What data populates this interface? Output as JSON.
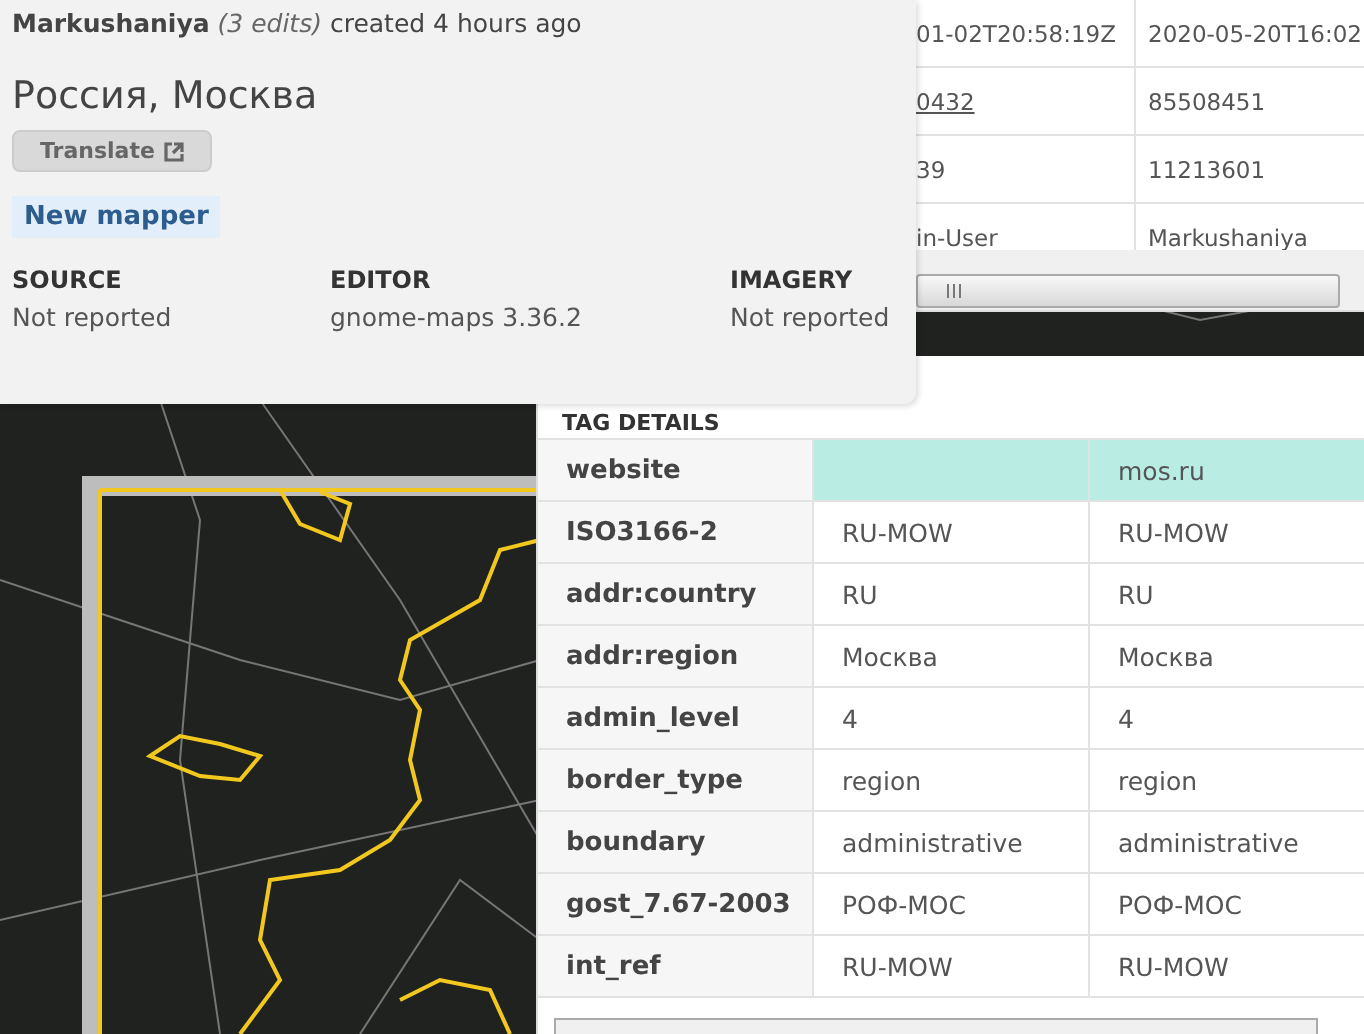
{
  "popup": {
    "author": "Markushaniya",
    "edits": "(3 edits)",
    "created": "created 4 hours ago",
    "title": "Россия, Москва",
    "translate_button": "Translate",
    "badge": "New mapper",
    "meta": [
      {
        "label": "SOURCE",
        "value": "Not reported"
      },
      {
        "label": "EDITOR",
        "value": "gnome-maps 3.36.2"
      },
      {
        "label": "IMAGERY",
        "value": "Not reported"
      }
    ]
  },
  "history_table": {
    "rows": [
      {
        "column_1": "01-02T20:58:19Z",
        "column_2": "2020-05-20T16:02",
        "link": false
      },
      {
        "column_1": "0432",
        "column_2": "85508451",
        "link": true
      },
      {
        "column_1": "39",
        "column_2": "11213601",
        "link": false
      },
      {
        "column_1": "in-User",
        "column_2": "Markushaniya",
        "link": false
      }
    ]
  },
  "tag_details": {
    "title": "TAG DETAILS",
    "rows": [
      {
        "key": "website",
        "old": "",
        "new": "mos.ru",
        "changed": true
      },
      {
        "key": "ISO3166-2",
        "old": "RU-MOW",
        "new": "RU-MOW",
        "changed": false
      },
      {
        "key": "addr:country",
        "old": "RU",
        "new": "RU",
        "changed": false
      },
      {
        "key": "addr:region",
        "old": "Москва",
        "new": "Москва",
        "changed": false
      },
      {
        "key": "admin_level",
        "old": "4",
        "new": "4",
        "changed": false
      },
      {
        "key": "border_type",
        "old": "region",
        "new": "region",
        "changed": false
      },
      {
        "key": "boundary",
        "old": "administrative",
        "new": "administrative",
        "changed": false
      },
      {
        "key": "gost_7.67-2003",
        "old": "РОФ-МОС",
        "new": "РОФ-МОС",
        "changed": false
      },
      {
        "key": "int_ref",
        "old": "RU-MOW",
        "new": "RU-MOW",
        "changed": false
      }
    ]
  }
}
